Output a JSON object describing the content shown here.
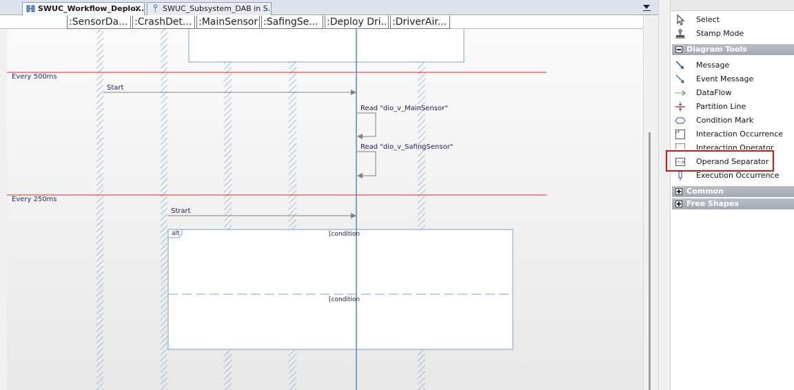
{
  "tabs": [
    {
      "label": "SWUC_Workflow_Deplo...",
      "close": "×",
      "active": true
    },
    {
      "label": "SWUC_Subsystem_DAB in S...",
      "active": false
    }
  ],
  "lifelines": [
    ":SensorDa...",
    ":CrashDet...",
    ":MainSensor",
    ":SafingSe...",
    ":Deploy Dri...",
    ":DriverAir..."
  ],
  "diagram": {
    "partition_1": "Every 500ms",
    "partition_2": "Every 250ms",
    "msg_start": "Start",
    "msg_read_main": "Read \"dio_v_MainSensor\"",
    "msg_read_safing": "Read \"dio_v_SafingSensor\"",
    "msg_strart": "Strart",
    "alt_label": "alt",
    "condition_1": "[condition",
    "condition_2": "[condition"
  },
  "toolbox": {
    "tools": [
      {
        "label": "Select",
        "icon": "cursor-arrow-icon"
      },
      {
        "label": "Stamp Mode",
        "icon": "stamp-icon"
      }
    ],
    "groups": [
      {
        "label": "Diagram Tools",
        "expanded": true,
        "items": [
          {
            "label": "Message",
            "icon": "message-arrow-icon"
          },
          {
            "label": "Event Message",
            "icon": "event-message-icon"
          },
          {
            "label": "DataFlow",
            "icon": "dataflow-icon"
          },
          {
            "label": "Partition Line",
            "icon": "partition-line-icon"
          },
          {
            "label": "Condition Mark",
            "icon": "condition-mark-icon"
          },
          {
            "label": "Interaction Occurrence",
            "icon": "interaction-occurrence-icon"
          },
          {
            "label": "Interaction Operator",
            "icon": "interaction-operator-icon"
          },
          {
            "label": "Operand Separator",
            "icon": "operand-separator-icon"
          },
          {
            "label": "Execution Occurrence",
            "icon": "execution-occurrence-icon"
          }
        ]
      },
      {
        "label": "Common",
        "expanded": false
      },
      {
        "label": "Free Shapes",
        "expanded": false
      }
    ]
  },
  "colors": {
    "partition_line": "#e02020",
    "highlight": "#e01010",
    "lifeline": "#5b8fc9",
    "group_header": "#a9aeb8"
  }
}
